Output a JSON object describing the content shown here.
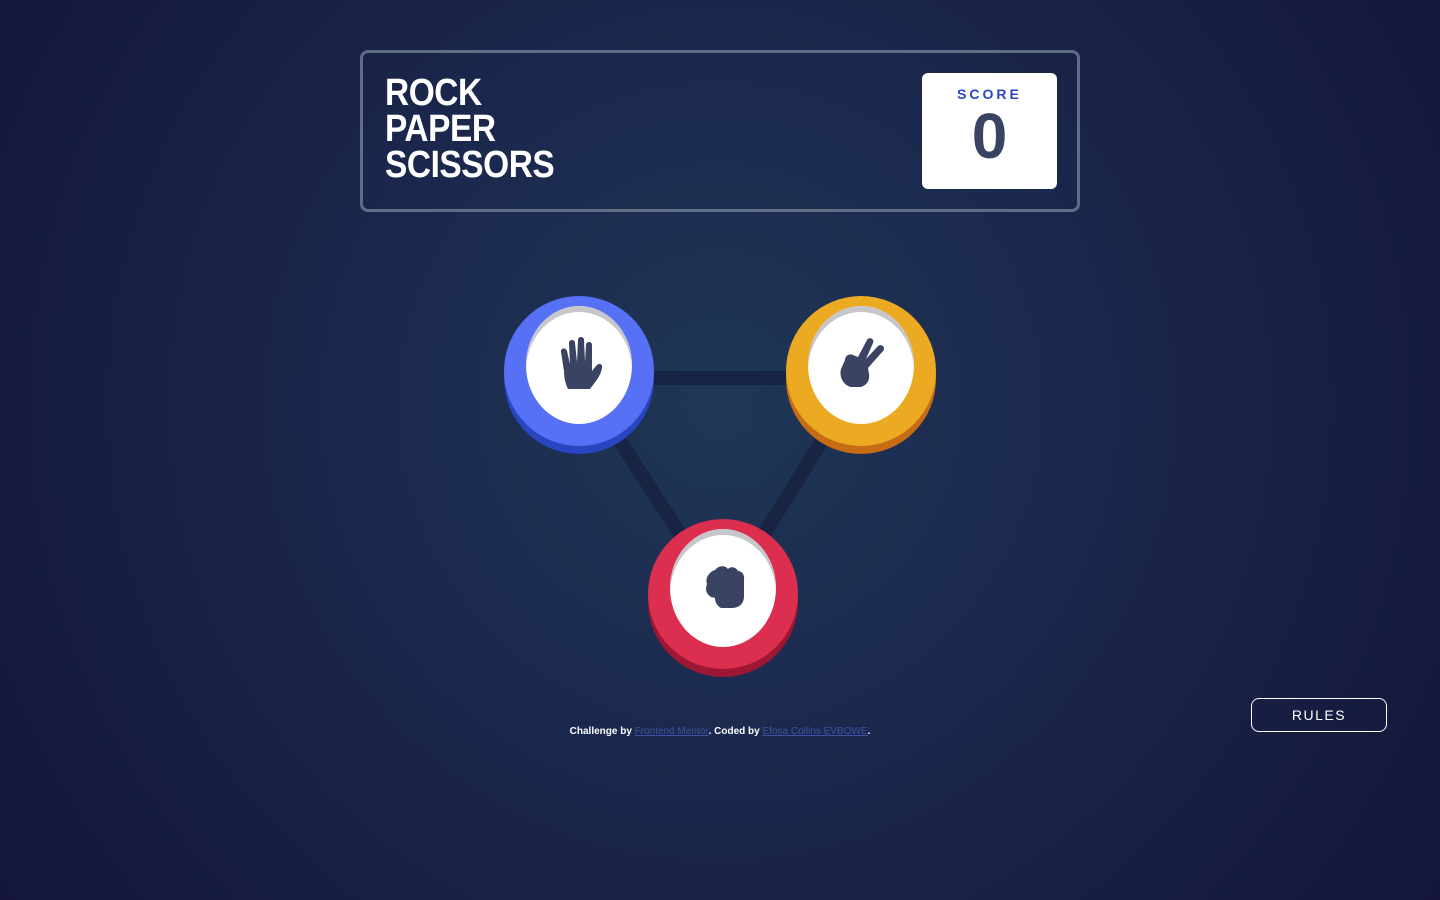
{
  "header": {
    "title_lines": [
      "ROCK",
      "PAPER",
      "SCISSORS"
    ],
    "score_label": "SCORE",
    "score_value": "0"
  },
  "choices": [
    {
      "id": "paper",
      "icon": "paper-hand-icon",
      "ring_color": "#5671f5",
      "shadow_color": "#2a45c2"
    },
    {
      "id": "scissors",
      "icon": "scissors-hand-icon",
      "ring_color": "#eca922",
      "shadow_color": "#c76c14"
    },
    {
      "id": "rock",
      "icon": "rock-fist-icon",
      "ring_color": "#dc2e4e",
      "shadow_color": "#9d1634"
    }
  ],
  "footer": {
    "challenge_prefix": "Challenge by ",
    "challenge_link": "Frontend Mentor",
    "coded_prefix": ". Coded by ",
    "coded_link": "Efosa Collins EVBOWE",
    "suffix": "."
  },
  "rules_button": "RULES",
  "colors": {
    "background_center": "#1f3756",
    "background_edge": "#141539",
    "header_outline": "#606e85",
    "score_text": "#3b4363",
    "score_label": "#2a46c0",
    "link": "#3e52a3"
  }
}
